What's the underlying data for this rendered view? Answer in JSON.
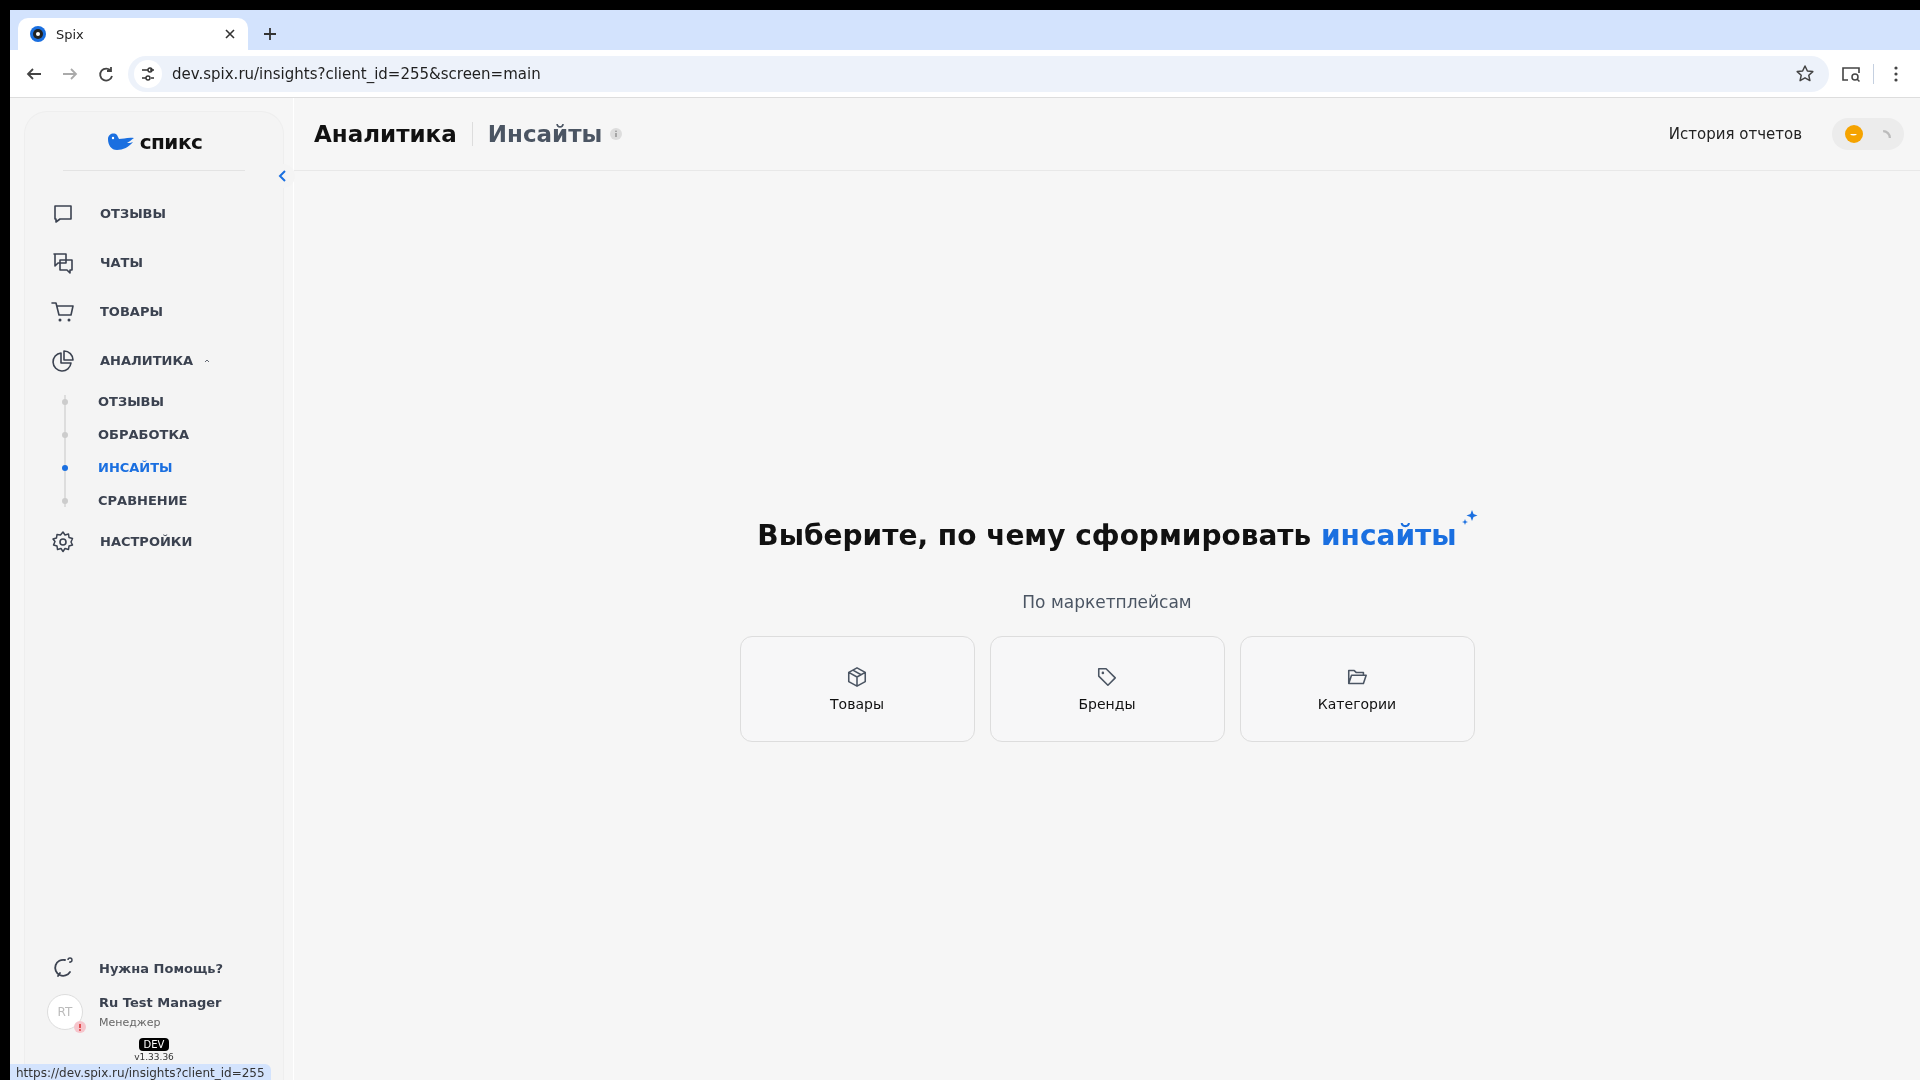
{
  "browser": {
    "tab_title": "Spix",
    "url": "dev.spix.ru/insights?client_id=255&screen=main",
    "status_url": "https://dev.spix.ru/insights?client_id=255"
  },
  "sidebar": {
    "logo_text": "спикс",
    "items": [
      {
        "label": "ОТЗЫВЫ",
        "selected": false
      },
      {
        "label": "ЧАТЫ",
        "selected": false
      },
      {
        "label": "ТОВАРЫ",
        "selected": false
      },
      {
        "label": "АНАЛИТИКА",
        "selected": false,
        "expanded": true,
        "children": [
          {
            "label": "ОТЗЫВЫ",
            "selected": false
          },
          {
            "label": "ОБРАБОТКА",
            "selected": false
          },
          {
            "label": "ИНСАЙТЫ",
            "selected": true
          },
          {
            "label": "СРАВНЕНИЕ",
            "selected": false
          }
        ]
      },
      {
        "label": "НАСТРОЙКИ",
        "selected": false
      }
    ],
    "help": "Нужна Помощь?",
    "user": {
      "initials": "RT",
      "name": "Ru Test Manager",
      "role": "Менеджер"
    },
    "env_badge": "DEV",
    "version": "v1.33.36"
  },
  "header": {
    "title": "Аналитика",
    "subtitle": "Инсайты",
    "history_button": "История отчетов"
  },
  "main": {
    "heading": "Выберите, по чему сформировать",
    "heading_accent": "инсайты",
    "section_label": "По маркетплейсам",
    "cards": [
      {
        "label": "Товары"
      },
      {
        "label": "Бренды"
      },
      {
        "label": "Категории"
      }
    ]
  }
}
